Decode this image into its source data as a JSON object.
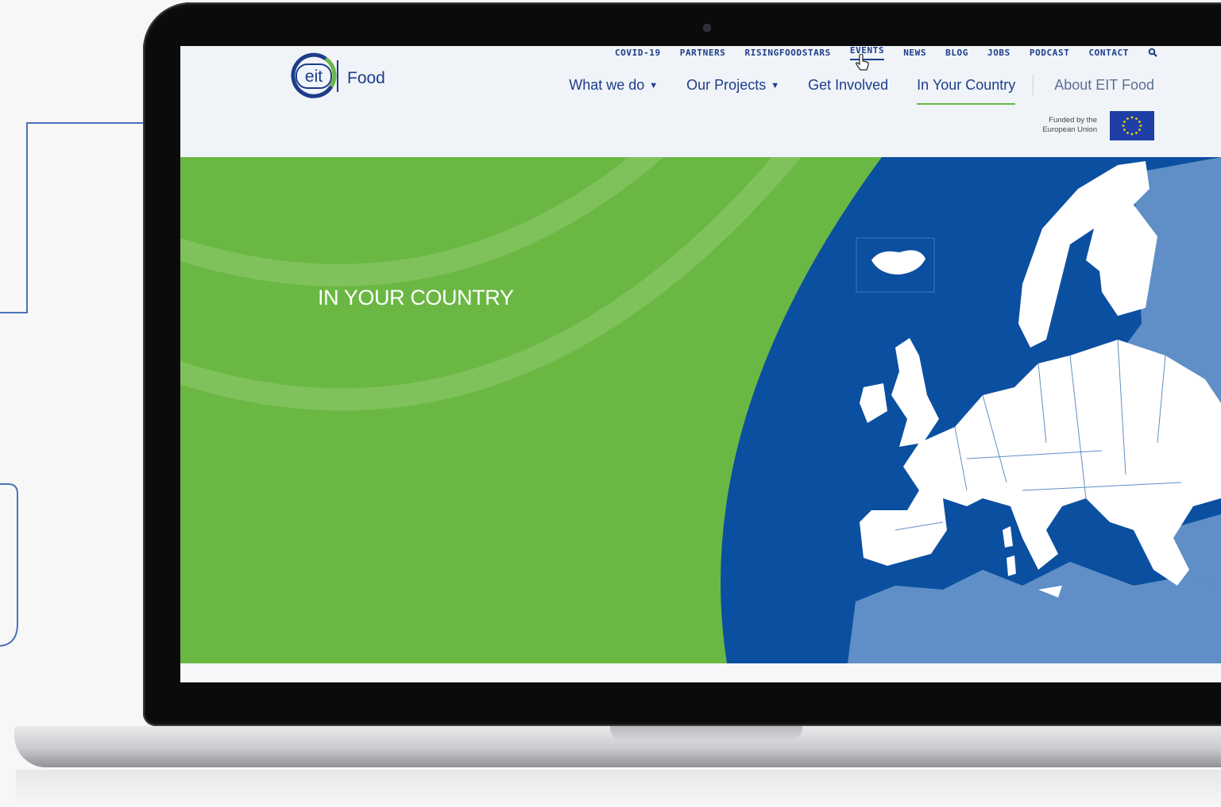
{
  "utility_nav": [
    "COVID-19",
    "PARTNERS",
    "RISINGFOODSTARS",
    "EVENTS",
    "NEWS",
    "BLOG",
    "JOBS",
    "PODCAST",
    "CONTACT"
  ],
  "main_nav": {
    "what_we_do": "What we do",
    "our_projects": "Our Projects",
    "get_involved": "Get Involved",
    "in_your_country": "In Your Country",
    "about": "About EIT Food"
  },
  "logo": {
    "mark": "eit",
    "word": "Food"
  },
  "funding": {
    "line1": "Funded by the",
    "line2": "European Union"
  },
  "hero": {
    "title": "IN YOUR COUNTRY"
  },
  "colors": {
    "brand_blue": "#1c3d8a",
    "hero_green": "#6bb744",
    "map_ocean": "#0b4fa0",
    "map_neighbors": "#5f8fc6",
    "map_land": "#ffffff",
    "annotation": "#4a72b8"
  },
  "icons": {
    "search": "search-icon",
    "cursor": "hand-cursor-icon",
    "flag": "eu-flag-icon"
  }
}
